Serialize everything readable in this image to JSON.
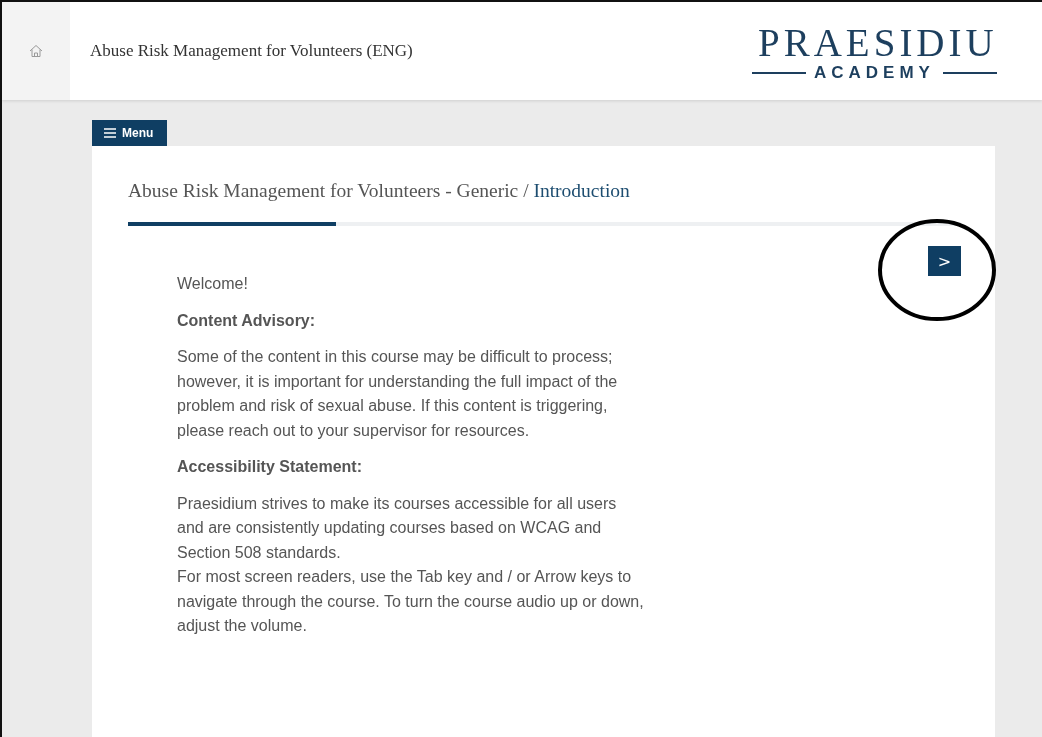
{
  "header": {
    "title": "Abuse Risk Management for Volunteers (ENG)",
    "logo": {
      "name": "PRAESIDIU",
      "tagline": "ACADEMY"
    }
  },
  "menu_button": {
    "label": "Menu"
  },
  "breadcrumb": {
    "course": "Abuse Risk Management for Volunteers - Generic",
    "separator": "/",
    "section": "Introduction"
  },
  "progress": {
    "level": 0.25
  },
  "next_button": {
    "label": ">",
    "highlighted": true
  },
  "content": [
    {
      "kind": "text",
      "text": "Welcome!"
    },
    {
      "kind": "heading",
      "text": "Content Advisory:"
    },
    {
      "kind": "text",
      "text": "Some of the content in this course may be difficult to process; however, it is important for understanding the full impact of the problem and risk of sexual abuse. If this content is triggering, please reach out to your supervisor for resources."
    },
    {
      "kind": "heading",
      "text": "Accessibility Statement:"
    },
    {
      "kind": "text",
      "text": "Praesidium strives to make its courses accessible for all users and are consistently updating courses based on WCAG and Section 508 standards."
    },
    {
      "kind": "continued",
      "text": "For most screen readers, use the Tab key and / or Arrow keys to navigate through the course. To turn the course audio up or down, adjust the volume."
    }
  ]
}
